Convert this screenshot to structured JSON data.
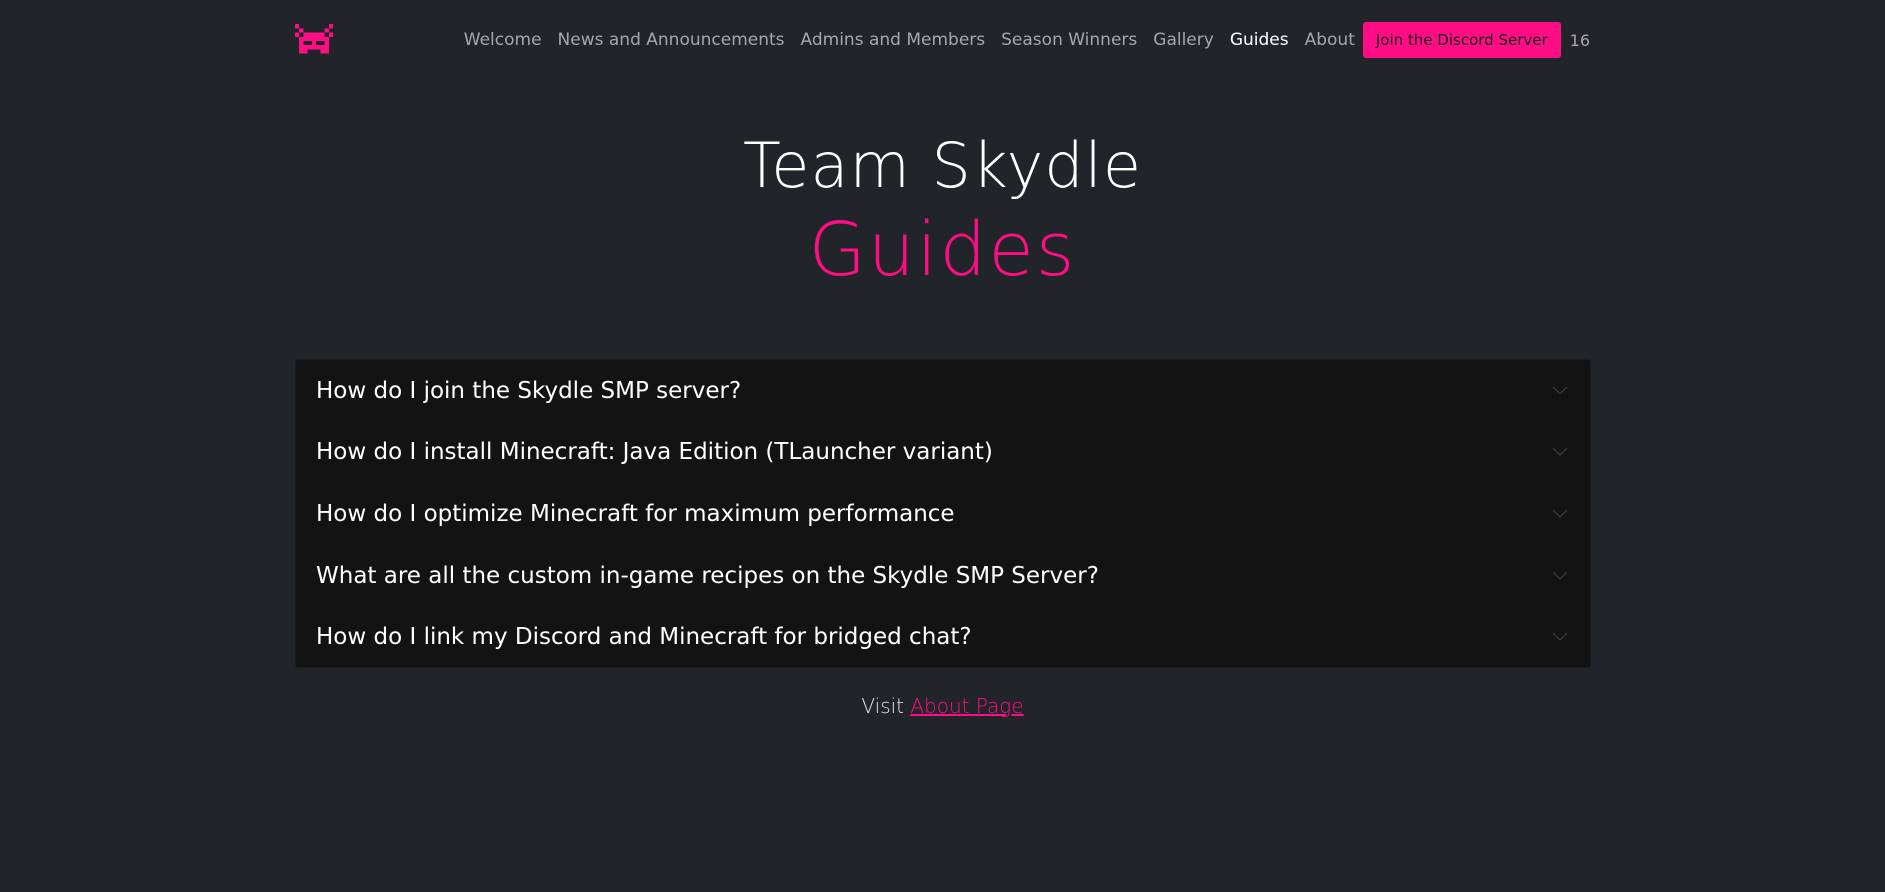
{
  "nav": {
    "logo": "skydle-logo",
    "links": [
      {
        "label": "Welcome"
      },
      {
        "label": "News and Announcements"
      },
      {
        "label": "Admins and Members"
      },
      {
        "label": "Season Winners"
      },
      {
        "label": "Gallery"
      },
      {
        "label": "Guides",
        "active": true
      },
      {
        "label": "About"
      }
    ],
    "discord_button": "Join the Discord Server",
    "counter": "16"
  },
  "hero": {
    "title": "Team Skydle",
    "subtitle": "Guides"
  },
  "guides": [
    {
      "question": "How do I join the Skydle SMP server?",
      "icon": "chevron-down-icon"
    },
    {
      "question": "How do I install Minecraft: Java Edition (TLauncher variant)",
      "icon": "chevron-down-icon"
    },
    {
      "question": "How do I optimize Minecraft for maximum performance",
      "icon": "chevron-down-icon"
    },
    {
      "question": "What are all the custom in-game recipes on the Skydle SMP Server?",
      "icon": "chevron-down-icon"
    },
    {
      "question": "How do I link my Discord and Minecraft for bridged chat?",
      "icon": "chevron-down-icon"
    }
  ],
  "footer": {
    "visit_text": "Visit",
    "about_link": "About Page"
  },
  "colors": {
    "background": "#212529",
    "accent": "#ff0d84",
    "accordion_bg": "#131313",
    "nav_text": "#a4a8ad"
  }
}
